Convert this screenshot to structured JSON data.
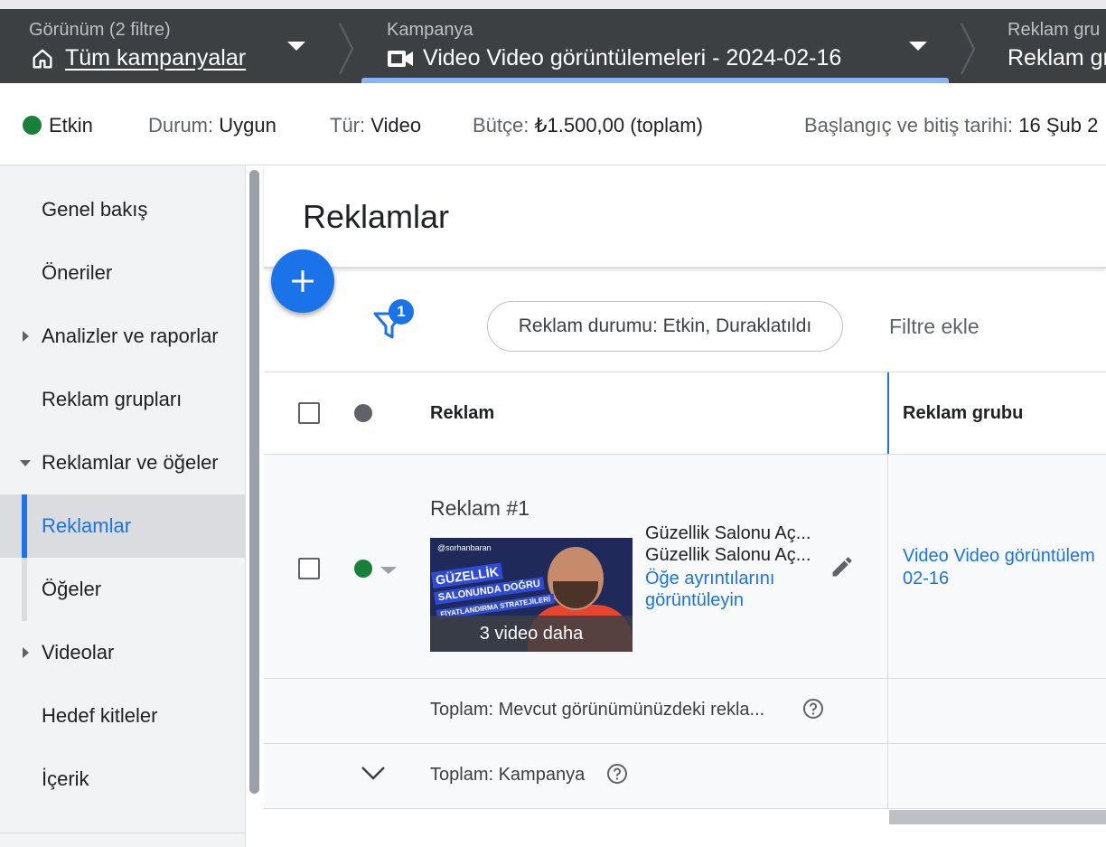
{
  "breadcrumb": {
    "view": {
      "label": "Görünüm (2 filtre)",
      "value": "Tüm kampanyalar",
      "icon": "home-icon"
    },
    "campaign": {
      "label": "Kampanya",
      "value": "Video Video görüntülemeleri - 2024-02-16",
      "icon": "video-camera-icon"
    },
    "adgroup": {
      "label": "Reklam gru",
      "value": "Reklam gr"
    }
  },
  "status_bar": {
    "status_value": "Etkin",
    "durum_label": "Durum:",
    "durum_value": "Uygun",
    "tur_label": "Tür:",
    "tur_value": "Video",
    "butce_label": "Bütçe:",
    "butce_value": "₺1.500,00 (toplam)",
    "dates_label": "Başlangıç ve bitiş tarihi:",
    "dates_value": "16 Şub 2"
  },
  "sidebar": {
    "items": [
      {
        "label": "Genel bakış"
      },
      {
        "label": "Öneriler"
      },
      {
        "label": "Analizler ve raporlar"
      },
      {
        "label": "Reklam grupları"
      },
      {
        "label": "Reklamlar ve öğeler"
      },
      {
        "label": "Reklamlar"
      },
      {
        "label": "Öğeler"
      },
      {
        "label": "Videolar"
      },
      {
        "label": "Hedef kitleler"
      },
      {
        "label": "İçerik"
      }
    ]
  },
  "main": {
    "title": "Reklamlar",
    "filter_count": "1",
    "filter_chip": "Reklam durumu: Etkin, Duraklatıldı",
    "add_filter": "Filtre ekle",
    "columns": {
      "ad": "Reklam",
      "adgroup": "Reklam grubu"
    },
    "row": {
      "title": "Reklam #1",
      "thumb_tag": "@sorhanbaran",
      "thumb_line1": "GÜZELLİK",
      "thumb_line2": "SALONUNDA DOĞRU",
      "thumb_line3": "FİYATLANDIRMA STRATEJİLERİ",
      "thumb_more": "3 video daha",
      "headline1": "Güzellik Salonu Aç...",
      "headline2": "Güzellik Salonu Aç...",
      "link_line1": "Öğe ayrıntılarını",
      "link_line2": "görüntüleyin",
      "adgroup_line1": "Video Video görüntülem",
      "adgroup_line2": "02-16"
    },
    "totals": {
      "view": "Toplam: Mevcut görünümünüzdeki rekla...",
      "campaign": "Toplam: Kampanya"
    }
  }
}
